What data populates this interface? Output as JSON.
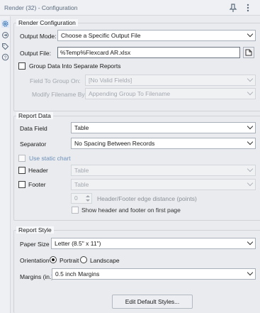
{
  "header": {
    "tool_name": "Render (32)",
    "separator": " - ",
    "subtitle": "Configuration",
    "pin_icon": "pin-icon",
    "more_icon": "more-vertical-icon"
  },
  "sidebar": {
    "items": [
      {
        "icon": "gear-icon",
        "active": true
      },
      {
        "icon": "connection-icon",
        "active": false
      },
      {
        "icon": "tag-icon",
        "active": false
      },
      {
        "icon": "help-icon",
        "active": false
      }
    ]
  },
  "render_config": {
    "legend": "Render Configuration",
    "output_mode_label": "Output Mode:",
    "output_mode_value": "Choose a Specific Output File",
    "output_file_label": "Output File:",
    "output_file_value": "%Temp%Flexcard AR.xlsx",
    "group_label": "Group Data Into Separate Reports",
    "field_group_label": "Field To Group On:",
    "field_group_value": "[No Valid Fields]",
    "modify_filename_label": "Modify Filename By:",
    "modify_filename_value": "Appending Group To Filename"
  },
  "report_data": {
    "legend": "Report Data",
    "data_field_label": "Data Field",
    "data_field_value": "Table",
    "separator_label": "Separator",
    "separator_value": "No Spacing Between Records",
    "static_chart_label": "Use static chart",
    "header_label": "Header",
    "header_value": "Table",
    "footer_label": "Footer",
    "footer_value": "Table",
    "edge_distance_value": "0",
    "edge_distance_label": "Header/Footer edge distance (points)",
    "show_header_footer_label": "Show header and footer on first page"
  },
  "report_style": {
    "legend": "Report Style",
    "paper_size_label": "Paper Size",
    "paper_size_value": "Letter (8.5\" x 11\")",
    "orientation_label": "Orientation",
    "portrait_label": "Portrait",
    "landscape_label": "Landscape",
    "orientation_selected": "Portrait",
    "margins_label": "Margins (in.)",
    "margins_value": "0.5 inch Margins",
    "edit_styles_label": "Edit Default Styles..."
  }
}
